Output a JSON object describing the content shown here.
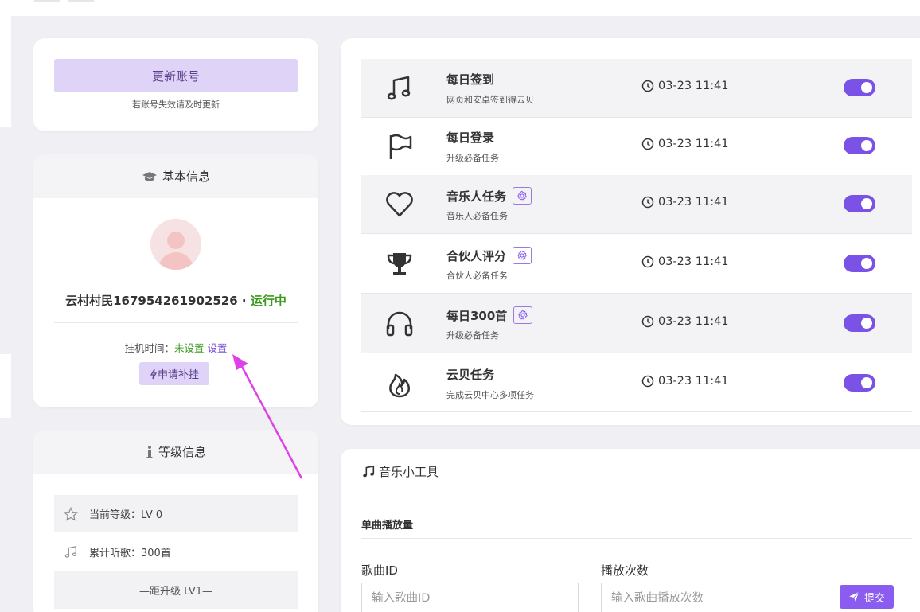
{
  "account": {
    "update_button": "更新账号",
    "update_hint": "若账号失效请及时更新"
  },
  "basic_info": {
    "title": "基本信息",
    "nickname": "云村村民167954261902526",
    "separator": " · ",
    "status": "运行中",
    "hang_label": "挂机时间：",
    "hang_value": "未设置",
    "set_link": "设置",
    "apply_button": "申请补挂"
  },
  "level_info": {
    "title": "等级信息",
    "current_level": "当前等级：LV 0",
    "listened": "累计听歌：300首",
    "next_level": "—距升级 LV1—"
  },
  "tasks": [
    {
      "title": "每日签到",
      "desc": "网页和安卓签到得云贝",
      "time": "03-23 11:41",
      "icon": "music-note-icon",
      "has_gear": false,
      "enabled": true
    },
    {
      "title": "每日登录",
      "desc": "升级必备任务",
      "time": "03-23 11:41",
      "icon": "flag-icon",
      "has_gear": false,
      "enabled": true
    },
    {
      "title": "音乐人任务",
      "desc": "音乐人必备任务",
      "time": "03-23 11:41",
      "icon": "heart-icon",
      "has_gear": true,
      "enabled": true
    },
    {
      "title": "合伙人评分",
      "desc": "合伙人必备任务",
      "time": "03-23 11:41",
      "icon": "trophy-icon",
      "has_gear": true,
      "enabled": true
    },
    {
      "title": "每日300首",
      "desc": "升级必备任务",
      "time": "03-23 11:41",
      "icon": "headphones-icon",
      "has_gear": true,
      "enabled": true
    },
    {
      "title": "云贝任务",
      "desc": "完成云贝中心多项任务",
      "time": "03-23 11:41",
      "icon": "fire-icon",
      "has_gear": false,
      "enabled": true
    }
  ],
  "music_tool": {
    "title": "音乐小工具",
    "section": "单曲播放量",
    "song_id_label": "歌曲ID",
    "song_id_placeholder": "输入歌曲ID",
    "play_count_label": "播放次数",
    "play_count_placeholder": "输入歌曲播放次数",
    "submit": "提交"
  },
  "colors": {
    "accent": "#7b52e6",
    "accent_light": "#e0d3f8",
    "success": "#3a9a1e",
    "annotation_arrow": "#e040e8"
  }
}
